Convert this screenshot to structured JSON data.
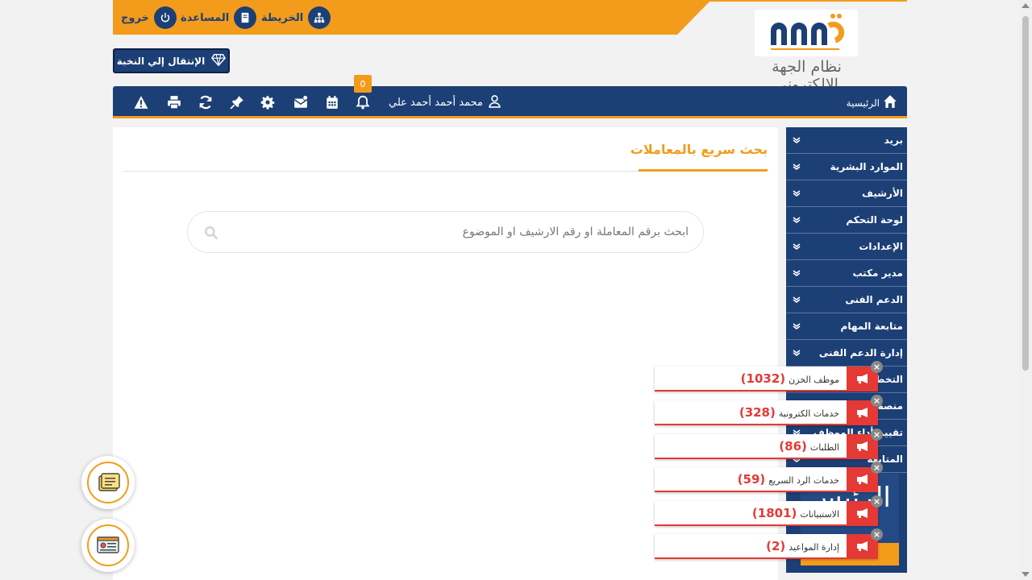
{
  "header": {
    "links": [
      {
        "label": "الخريطة",
        "icon": "sitemap-icon"
      },
      {
        "label": "المساعدة",
        "icon": "book-icon"
      },
      {
        "label": "خروج",
        "icon": "power-icon"
      }
    ],
    "logo_text": "نظام الجهة الإلكتروني",
    "elite_button": "الإنتقال إلي النخبة"
  },
  "navbar": {
    "home_label": "الرئيسية",
    "user_name": "محمد أحمد أحمد علي",
    "notification_count": "0",
    "icons": [
      "bell-icon",
      "calendar-icon",
      "envelope-icon",
      "gear-icon",
      "pin-icon",
      "refresh-icon",
      "print-icon",
      "warning-icon"
    ]
  },
  "main": {
    "title": "بحث سريع بالمعاملات",
    "search_placeholder": "ابحث برقم المعاملة او رقم الارشيف او الموضوع"
  },
  "sidebar": {
    "items": [
      "بريد",
      "الموارد البشرية",
      "الأرشيف",
      "لوحة التحكم",
      "الإعدادات",
      "مدير مكتب",
      "الدعم الفنى",
      "متابعة المهام",
      "إدارة الدعم الفنى",
      "التخطيط",
      "منصة",
      "تقييم أداء الموظف",
      "المتابعة"
    ],
    "widget_text": "الرئيس 21"
  },
  "popups": [
    {
      "label": "موظف الخزن",
      "count": "(1032)"
    },
    {
      "label": "خدمات الكترونية",
      "count": "(328)"
    },
    {
      "label": "الطلبات",
      "count": "(86)"
    },
    {
      "label": "خدمات الرد السريع",
      "count": "(59)"
    },
    {
      "label": "الاستبيانات",
      "count": "(1801)"
    },
    {
      "label": "إدارة المواعيد",
      "count": "(2)"
    }
  ],
  "colors": {
    "accent": "#f39c1b",
    "primary": "#1c3f76",
    "alert": "#e53935"
  }
}
